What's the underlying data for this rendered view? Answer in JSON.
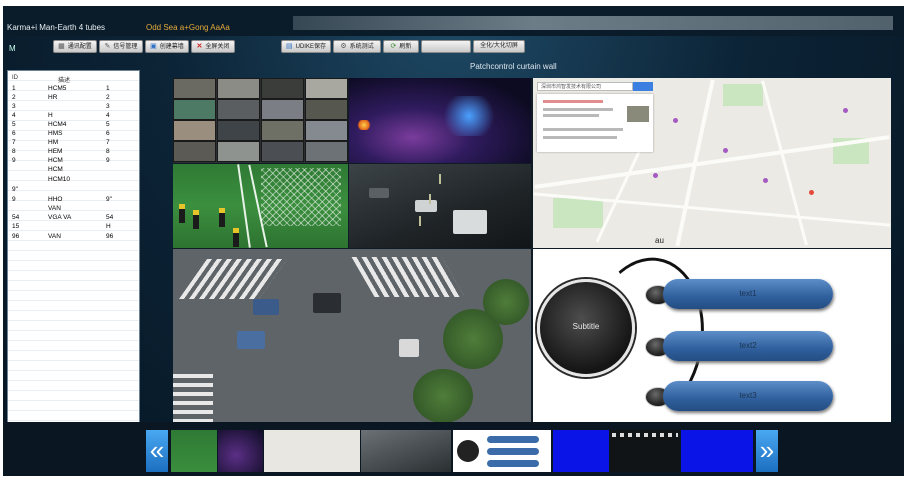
{
  "titlebar": {
    "left_text": "Karma+i Man-Earth 4 tubes",
    "mid_text": "Odd Sea a+Gong AaAa"
  },
  "toolbar": {
    "m_label": "M",
    "buttons": [
      {
        "icon": "grid-icon",
        "label": "通讯配置"
      },
      {
        "icon": "edit-icon",
        "label": "信号管理"
      },
      {
        "icon": "window-icon",
        "label": "创建幕墙"
      },
      {
        "icon": "close-icon",
        "label": "全屏关闭"
      },
      {
        "icon": "scene-icon",
        "label": "UDIKE保存"
      },
      {
        "icon": "settings-icon",
        "label": "系统测试"
      },
      {
        "icon": "refresh-icon",
        "label": "刷新"
      },
      {
        "icon": "blank",
        "label": ""
      },
      {
        "icon": "blank",
        "label": "全化/大化切屏"
      }
    ]
  },
  "wall": {
    "title": "Patchcontrol curtain wall",
    "map_label": "au",
    "map_search": "深圳市鸿智发技术有限公司",
    "diagram": {
      "subtitle": "Subtitle",
      "items": [
        "text1",
        "text2",
        "text3"
      ]
    }
  },
  "signal_list": {
    "headers": [
      "ID",
      "描述",
      ""
    ],
    "rows": [
      [
        "1",
        "HCM5",
        "1"
      ],
      [
        "2",
        "HR",
        "2"
      ],
      [
        "3",
        "",
        "3"
      ],
      [
        "4",
        "H",
        "4"
      ],
      [
        "5",
        "HCM4",
        "5"
      ],
      [
        "6",
        "HMS",
        "6"
      ],
      [
        "7",
        "HM",
        "7"
      ],
      [
        "8",
        "HEM",
        "8"
      ],
      [
        "9",
        "HCM",
        "9"
      ],
      [
        "",
        "HCM",
        ""
      ],
      [
        "",
        "HCM10",
        ""
      ],
      [
        "9\"",
        "",
        ""
      ],
      [
        "9",
        "HHO",
        "9\""
      ],
      [
        "",
        "VAN",
        ""
      ],
      [
        "54",
        "VGA VA",
        "54"
      ],
      [
        "15",
        "",
        "H"
      ],
      [
        "96",
        "VAN",
        "96"
      ]
    ]
  },
  "thumbnails": [
    {
      "name": "thumb-soccer"
    },
    {
      "name": "thumb-game"
    },
    {
      "name": "thumb-map"
    },
    {
      "name": "thumb-night-road"
    },
    {
      "name": "thumb-diagram"
    },
    {
      "name": "thumb-blue"
    },
    {
      "name": "thumb-dark"
    },
    {
      "name": "thumb-blue-2"
    }
  ],
  "colors": {
    "background": "#0c2437",
    "accent_blue": "#2f5f9c",
    "title_orange": "#e4a93a"
  }
}
